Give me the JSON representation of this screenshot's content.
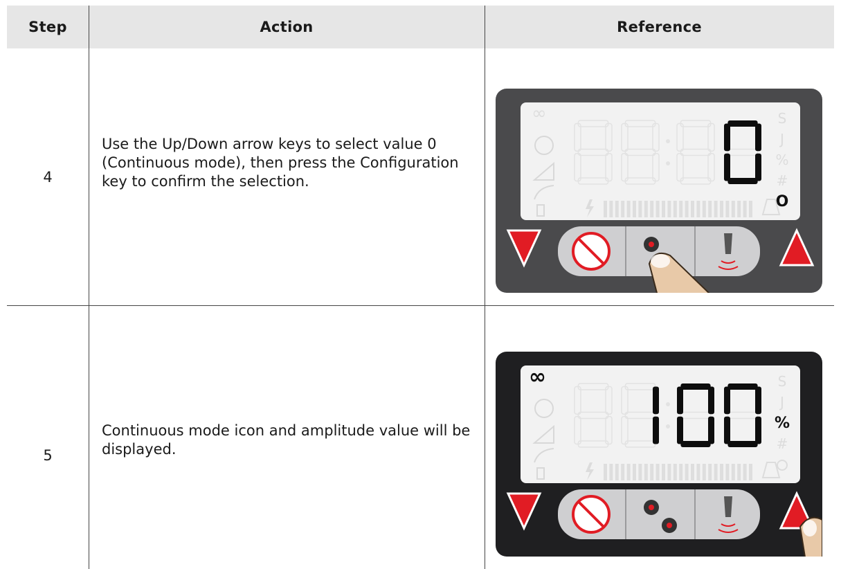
{
  "table": {
    "headers": {
      "step": "Step",
      "action": "Action",
      "reference": "Reference"
    },
    "rows": [
      {
        "step": "4",
        "action": "Use the Up/Down arrow keys to select value 0 (Continuous mode), then press the Configuration key to confirm the selection.",
        "display": {
          "digits": "0",
          "unit_labels": [
            "S",
            "J",
            "%",
            "#"
          ],
          "indicator": "O",
          "active_unit": "O",
          "continuous_icon_on": false,
          "pressed_key": "configuration-key",
          "colors": {
            "bezel": "#4a4a4c",
            "lcd": "#f2f2f2",
            "arrow": "#e11c24"
          }
        }
      },
      {
        "step": "5",
        "action": "Continuous mode icon and amplitude value will be displayed.",
        "display": {
          "digits": "100",
          "unit_labels": [
            "S",
            "J",
            "#"
          ],
          "indicator": "%",
          "active_unit": "%",
          "continuous_icon": "∞",
          "continuous_icon_on": true,
          "pressed_key": "up-arrow-key",
          "colors": {
            "bezel": "#1f1f21",
            "lcd": "#f2f2f2",
            "arrow": "#e11c24"
          }
        }
      }
    ]
  }
}
